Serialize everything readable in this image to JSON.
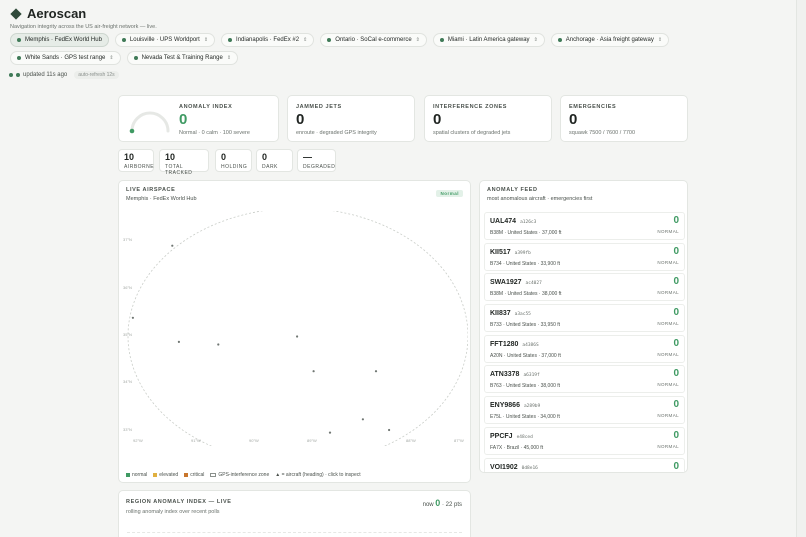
{
  "app": {
    "title": "Aeroscan",
    "tagline": "Navigation integrity across the US air-freight network — live."
  },
  "regions": [
    {
      "label": "Memphis · FedEx World Hub",
      "active": true
    },
    {
      "label": "Louisville · UPS Worldport",
      "active": false
    },
    {
      "label": "Indianapolis · FedEx #2",
      "active": false
    },
    {
      "label": "Ontario · SoCal e-commerce",
      "active": false
    },
    {
      "label": "Miami · Latin America gateway",
      "active": false
    },
    {
      "label": "Anchorage · Asia freight gateway",
      "active": false
    },
    {
      "label": "White Sands · GPS test range",
      "active": false
    },
    {
      "label": "Nevada Test & Training Range",
      "active": false
    }
  ],
  "status": {
    "updated": "updated 11s ago",
    "auto_refresh": "auto-refresh 12s"
  },
  "anomaly_index": {
    "label": "Anomaly Index",
    "value": "0",
    "detail": "Normal · 0 calm · 100 severe",
    "gauge_fraction": 0
  },
  "stats": [
    {
      "label": "Jammed Jets",
      "value": "0",
      "detail": "enroute · degraded GPS integrity"
    },
    {
      "label": "Interference Zones",
      "value": "0",
      "detail": "spatial clusters of degraded jets"
    },
    {
      "label": "Emergencies",
      "value": "0",
      "detail": "squawk 7500 / 7600 / 7700"
    }
  ],
  "mini_stats": [
    {
      "value": "10",
      "label": "Airborne"
    },
    {
      "value": "10",
      "label": "Total Tracked"
    },
    {
      "value": "0",
      "label": "Holding"
    },
    {
      "value": "0",
      "label": "Dark"
    },
    {
      "value": "—",
      "label": "Degraded"
    }
  ],
  "airspace": {
    "title": "Live Airspace",
    "location": "Memphis · FedEx World Hub",
    "badge": "Normal",
    "lat_labels": [
      "37°N",
      "36°N",
      "35°N",
      "34°N",
      "33°N"
    ],
    "lon_labels": [
      "92°W",
      "91°W",
      "90°W",
      "89°W",
      "88°W",
      "87°W"
    ],
    "aircraft": [
      {
        "lon": 91.5,
        "lat": 36.55
      },
      {
        "lon": 92.1,
        "lat": 35.2
      },
      {
        "lon": 91.4,
        "lat": 34.75
      },
      {
        "lon": 90.8,
        "lat": 34.7
      },
      {
        "lon": 89.6,
        "lat": 34.85
      },
      {
        "lon": 89.35,
        "lat": 34.2
      },
      {
        "lon": 88.4,
        "lat": 34.2
      },
      {
        "lon": 89.1,
        "lat": 33.05
      },
      {
        "lon": 88.6,
        "lat": 33.3
      },
      {
        "lon": 88.2,
        "lat": 33.1
      }
    ],
    "legend": {
      "normal": "normal",
      "elevated": "elevated",
      "critical": "critical",
      "zone": "GPS-interference zone",
      "aircraft": "▲ = aircraft (heading) · click to inspect"
    },
    "colors": {
      "normal": "#3f9a63",
      "elevated": "#e0b040",
      "critical": "#c8762c"
    }
  },
  "feed": {
    "title": "Anomaly Feed",
    "subtitle": "most anomalous aircraft · emergencies first",
    "items": [
      {
        "callsign": "UAL474",
        "hex": "a126c3",
        "detail": "B38M · United States · 37,000 ft",
        "score": "0",
        "status": "Normal"
      },
      {
        "callsign": "KII517",
        "hex": "a399fb",
        "detail": "B734 · United States · 33,900 ft",
        "score": "0",
        "status": "Normal"
      },
      {
        "callsign": "SWA1927",
        "hex": "ac4027",
        "detail": "B38M · United States · 38,000 ft",
        "score": "0",
        "status": "Normal"
      },
      {
        "callsign": "KII837",
        "hex": "a3ac55",
        "detail": "B733 · United States · 33,950 ft",
        "score": "0",
        "status": "Normal"
      },
      {
        "callsign": "FFT1280",
        "hex": "a4386S",
        "detail": "A20N · United States · 37,000 ft",
        "score": "0",
        "status": "Normal"
      },
      {
        "callsign": "ATN3378",
        "hex": "a6319f",
        "detail": "B763 · United States · 38,000 ft",
        "score": "0",
        "status": "Normal"
      },
      {
        "callsign": "ENY9866",
        "hex": "a289b9",
        "detail": "E75L · United States · 34,000 ft",
        "score": "0",
        "status": "Normal"
      },
      {
        "callsign": "PPCFJ",
        "hex": "e48ced",
        "detail": "FA7X · Brazil · 45,000 ft",
        "score": "0",
        "status": "Normal"
      },
      {
        "callsign": "VOI1902",
        "hex": "0d8e16",
        "detail": "",
        "score": "0",
        "status": ""
      }
    ]
  },
  "region_index": {
    "title": "Region Anomaly Index — Live",
    "subtitle": "rolling anomaly index over recent polls",
    "now_label": "now",
    "now_value": "0",
    "points": "· 22 pts"
  }
}
